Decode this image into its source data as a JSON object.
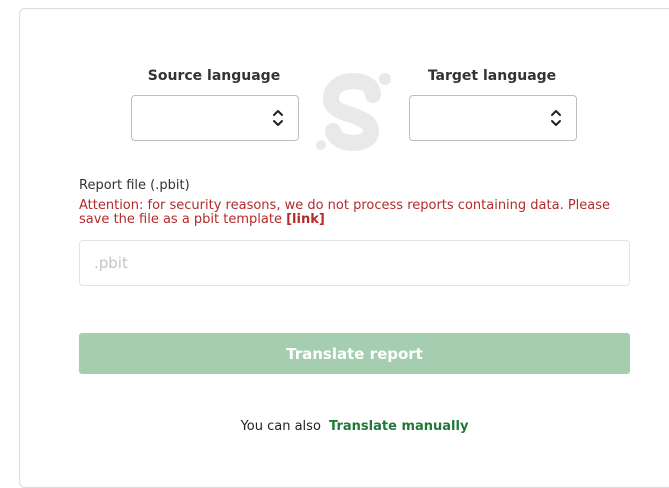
{
  "source_language": {
    "label": "Source language",
    "selected": ""
  },
  "target_language": {
    "label": "Target language",
    "selected": ""
  },
  "report": {
    "label": "Report file (.pbit)",
    "attention_text": "Attention: for security reasons, we do not process reports containing data. Please save the file as a pbit template",
    "link_text": "[link]",
    "file_placeholder": ".pbit"
  },
  "translate_button": "Translate report",
  "footer": {
    "prefix": "You can also",
    "manual_link": "Translate manually"
  },
  "colors": {
    "attention": "#b52a2a",
    "button_bg": "#a5cdb0",
    "link_green": "#1f7a37"
  }
}
